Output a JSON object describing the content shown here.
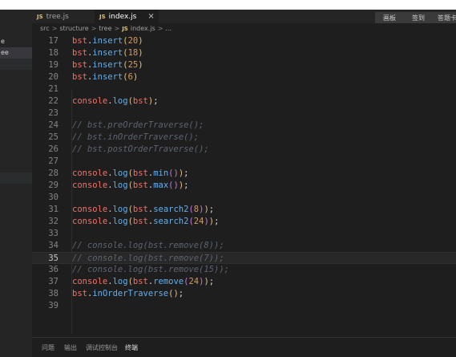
{
  "tabs": [
    {
      "label": "tree.js",
      "badge": "JS"
    },
    {
      "label": "index.js",
      "badge": "JS",
      "close": "×"
    }
  ],
  "top_buttons": [
    "画板",
    "签到",
    "答题卡"
  ],
  "sidebar": {
    "items": [
      "e",
      "ee"
    ]
  },
  "breadcrumb": {
    "items": [
      "src",
      "structure",
      "tree"
    ],
    "file_badge": "JS",
    "file": "index.js",
    "tail": "..."
  },
  "editor": {
    "current_line": "35",
    "lines": [
      {
        "num": "17",
        "tokens": [
          {
            "t": "bst",
            "c": "v"
          },
          {
            "t": ".",
            "c": "p"
          },
          {
            "t": "insert",
            "c": "f"
          },
          {
            "t": "(",
            "c": "y1"
          },
          {
            "t": "20",
            "c": "n"
          },
          {
            "t": ")",
            "c": "y1"
          }
        ]
      },
      {
        "num": "18",
        "tokens": [
          {
            "t": "bst",
            "c": "v"
          },
          {
            "t": ".",
            "c": "p"
          },
          {
            "t": "insert",
            "c": "f"
          },
          {
            "t": "(",
            "c": "y1"
          },
          {
            "t": "18",
            "c": "n"
          },
          {
            "t": ")",
            "c": "y1"
          }
        ]
      },
      {
        "num": "19",
        "tokens": [
          {
            "t": "bst",
            "c": "v"
          },
          {
            "t": ".",
            "c": "p"
          },
          {
            "t": "insert",
            "c": "f"
          },
          {
            "t": "(",
            "c": "y1"
          },
          {
            "t": "25",
            "c": "n"
          },
          {
            "t": ")",
            "c": "y1"
          }
        ]
      },
      {
        "num": "20",
        "tokens": [
          {
            "t": "bst",
            "c": "v"
          },
          {
            "t": ".",
            "c": "p"
          },
          {
            "t": "insert",
            "c": "f"
          },
          {
            "t": "(",
            "c": "y1"
          },
          {
            "t": "6",
            "c": "n"
          },
          {
            "t": ")",
            "c": "y1"
          }
        ]
      },
      {
        "num": "21",
        "tokens": []
      },
      {
        "num": "22",
        "tokens": [
          {
            "t": "console",
            "c": "v"
          },
          {
            "t": ".",
            "c": "p"
          },
          {
            "t": "log",
            "c": "f"
          },
          {
            "t": "(",
            "c": "y1"
          },
          {
            "t": "bst",
            "c": "v"
          },
          {
            "t": ")",
            "c": "y1"
          },
          {
            "t": ";",
            "c": "p"
          }
        ]
      },
      {
        "num": "23",
        "tokens": []
      },
      {
        "num": "24",
        "tokens": [
          {
            "t": "// bst.preOrderTraverse();",
            "c": "c"
          }
        ]
      },
      {
        "num": "25",
        "tokens": [
          {
            "t": "// bst.inOrderTraverse();",
            "c": "c"
          }
        ]
      },
      {
        "num": "26",
        "tokens": [
          {
            "t": "// bst.postOrderTraverse();",
            "c": "c"
          }
        ]
      },
      {
        "num": "27",
        "tokens": []
      },
      {
        "num": "28",
        "tokens": [
          {
            "t": "console",
            "c": "v"
          },
          {
            "t": ".",
            "c": "p"
          },
          {
            "t": "log",
            "c": "f"
          },
          {
            "t": "(",
            "c": "y1"
          },
          {
            "t": "bst",
            "c": "v"
          },
          {
            "t": ".",
            "c": "p"
          },
          {
            "t": "min",
            "c": "f"
          },
          {
            "t": "()",
            "c": "y2"
          },
          {
            "t": ")",
            "c": "y1"
          },
          {
            "t": ";",
            "c": "p"
          }
        ]
      },
      {
        "num": "29",
        "tokens": [
          {
            "t": "console",
            "c": "v"
          },
          {
            "t": ".",
            "c": "p"
          },
          {
            "t": "log",
            "c": "f"
          },
          {
            "t": "(",
            "c": "y1"
          },
          {
            "t": "bst",
            "c": "v"
          },
          {
            "t": ".",
            "c": "p"
          },
          {
            "t": "max",
            "c": "f"
          },
          {
            "t": "()",
            "c": "y2"
          },
          {
            "t": ")",
            "c": "y1"
          },
          {
            "t": ";",
            "c": "p"
          }
        ]
      },
      {
        "num": "30",
        "tokens": []
      },
      {
        "num": "31",
        "tokens": [
          {
            "t": "console",
            "c": "v"
          },
          {
            "t": ".",
            "c": "p"
          },
          {
            "t": "log",
            "c": "f"
          },
          {
            "t": "(",
            "c": "y1"
          },
          {
            "t": "bst",
            "c": "v"
          },
          {
            "t": ".",
            "c": "p"
          },
          {
            "t": "search2",
            "c": "f"
          },
          {
            "t": "(",
            "c": "y2"
          },
          {
            "t": "8",
            "c": "n"
          },
          {
            "t": ")",
            "c": "y2"
          },
          {
            "t": ")",
            "c": "y1"
          },
          {
            "t": ";",
            "c": "p"
          }
        ]
      },
      {
        "num": "32",
        "tokens": [
          {
            "t": "console",
            "c": "v"
          },
          {
            "t": ".",
            "c": "p"
          },
          {
            "t": "log",
            "c": "f"
          },
          {
            "t": "(",
            "c": "y1"
          },
          {
            "t": "bst",
            "c": "v"
          },
          {
            "t": ".",
            "c": "p"
          },
          {
            "t": "search2",
            "c": "f"
          },
          {
            "t": "(",
            "c": "y2"
          },
          {
            "t": "24",
            "c": "n"
          },
          {
            "t": ")",
            "c": "y2"
          },
          {
            "t": ")",
            "c": "y1"
          },
          {
            "t": ";",
            "c": "p"
          }
        ]
      },
      {
        "num": "33",
        "tokens": []
      },
      {
        "num": "34",
        "tokens": [
          {
            "t": "// console.log(bst.remove(8));",
            "c": "c"
          }
        ]
      },
      {
        "num": "35",
        "tokens": [
          {
            "t": "// console.log(bst.remove(7));",
            "c": "c"
          }
        ]
      },
      {
        "num": "36",
        "tokens": [
          {
            "t": "// console.log(bst.remove(15));",
            "c": "c"
          }
        ]
      },
      {
        "num": "37",
        "tokens": [
          {
            "t": "console",
            "c": "v"
          },
          {
            "t": ".",
            "c": "p"
          },
          {
            "t": "log",
            "c": "f"
          },
          {
            "t": "(",
            "c": "y1"
          },
          {
            "t": "bst",
            "c": "v"
          },
          {
            "t": ".",
            "c": "p"
          },
          {
            "t": "remove",
            "c": "f"
          },
          {
            "t": "(",
            "c": "y2"
          },
          {
            "t": "24",
            "c": "n"
          },
          {
            "t": ")",
            "c": "y2"
          },
          {
            "t": ")",
            "c": "y1"
          },
          {
            "t": ";",
            "c": "p"
          }
        ]
      },
      {
        "num": "38",
        "tokens": [
          {
            "t": "bst",
            "c": "v"
          },
          {
            "t": ".",
            "c": "p"
          },
          {
            "t": "inOrderTraverse",
            "c": "f"
          },
          {
            "t": "()",
            "c": "y1"
          },
          {
            "t": ";",
            "c": "p"
          }
        ]
      },
      {
        "num": "39",
        "tokens": []
      }
    ]
  },
  "panel": {
    "tabs": [
      "问题",
      "输出",
      "调试控制台",
      "终端"
    ],
    "active": "终端"
  }
}
